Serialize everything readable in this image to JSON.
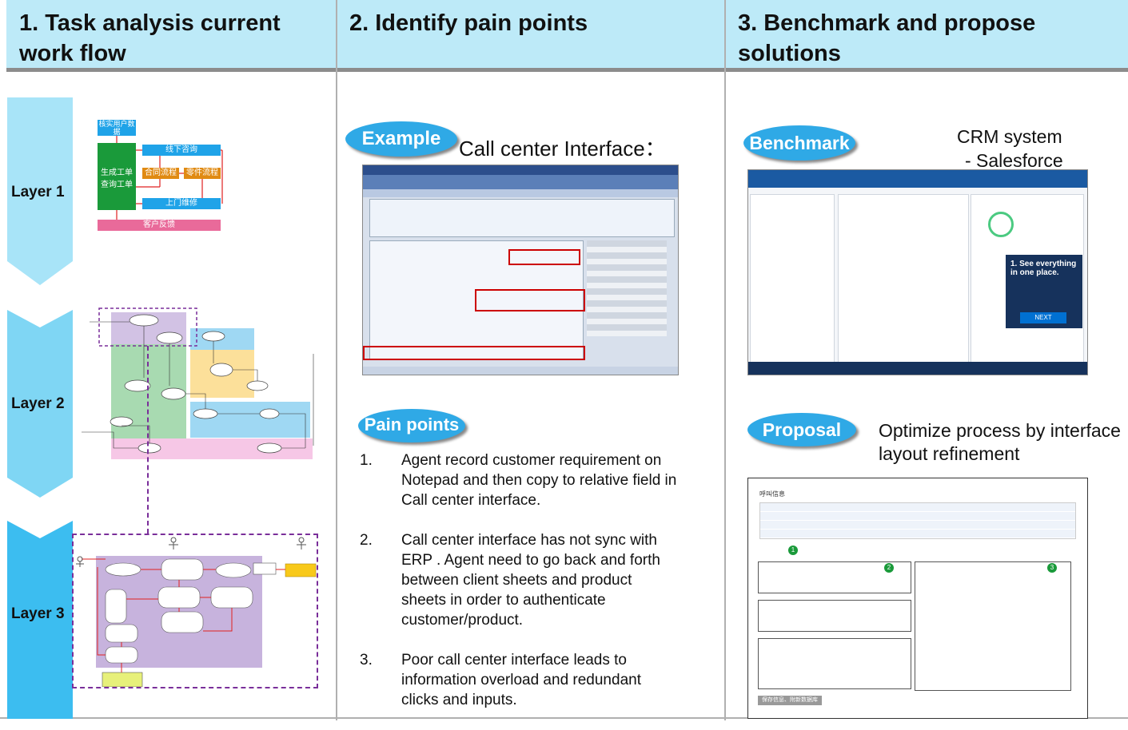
{
  "headers": {
    "col1": "1. Task analysis current\nwork flow",
    "col2": "2. Identify pain points",
    "col3": "3. Benchmark and propose\nsolutions"
  },
  "layers": [
    "Layer 1",
    "Layer 2",
    "Layer 3"
  ],
  "layer1_flow": {
    "top": "核实用户数据",
    "left": "生成工单\n查询工单",
    "offline": "线下咨询",
    "contract": "合同流程",
    "parts": "零件流程",
    "onsite": "上门维修",
    "feedback": "客户反馈"
  },
  "example": {
    "badge": "Example",
    "caption": "Call center Interface："
  },
  "pain_points": {
    "badge": "Pain points",
    "items": [
      {
        "num": "1.",
        "text": "Agent record customer requirement on Notepad and then copy to relative field in Call center interface."
      },
      {
        "num": "2.",
        "text": "Call center interface has not sync with ERP . Agent need to go back and forth between client sheets and product sheets in order to authenticate customer/product."
      },
      {
        "num": "3.",
        "text": "Poor call center interface leads to information overload and redundant clicks and inputs."
      }
    ]
  },
  "benchmark": {
    "badge": "Benchmark",
    "caption_line1": "CRM system",
    "caption_line2": "- Salesforce",
    "sf_popup_title": "1. See everything in one place.",
    "sf_next": "NEXT"
  },
  "proposal": {
    "badge": "Proposal",
    "caption": "Optimize process by interface layout refinement",
    "mock_title": "呼叫信息",
    "step1": "1",
    "step2": "2",
    "step3": "3",
    "save_btn": "保存信息、附新数据库"
  },
  "colors": {
    "header_bg": "#bdeaf8",
    "chevron": "#9ee0f7",
    "pill": "#2fa9e6",
    "flow_blue": "#1fa3e8",
    "flow_green": "#1a9a3a",
    "flow_orange": "#e08a12",
    "flow_pink": "#e96a9a"
  }
}
